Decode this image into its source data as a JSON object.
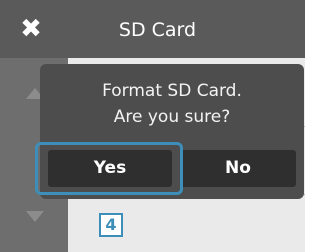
{
  "header": {
    "title": "SD Card",
    "close_icon": "close-icon"
  },
  "dialog": {
    "line1": "Format SD Card.",
    "line2": "Are you sure?",
    "yes_label": "Yes",
    "no_label": "No",
    "selected_button": "Yes"
  },
  "callout": {
    "step_number": "4"
  },
  "colors": {
    "header_bg": "#5a5a5a",
    "dialog_bg": "#4d4d4d",
    "button_bg": "#2f2f2f",
    "highlight": "#3d8fb9",
    "screen_bg": "#eaeaea"
  }
}
